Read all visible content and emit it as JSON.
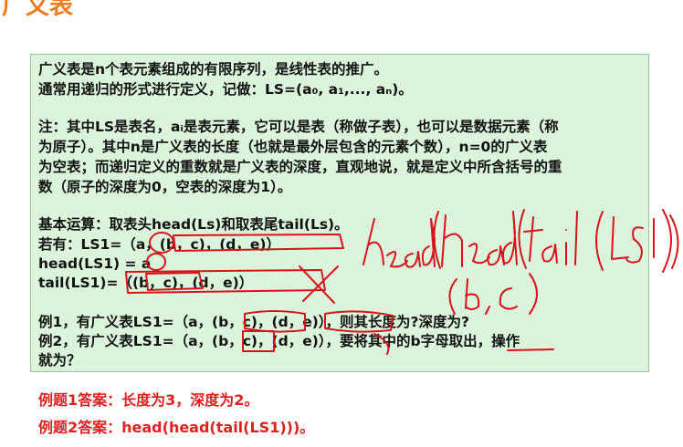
{
  "corner_title": "广义表",
  "box": {
    "lines": [
      "广义表是n个表元素组成的有限序列，是线性表的推广。",
      "通常用递归的形式进行定义，记做：LS=(a₀, a₁,..., aₙ)。",
      "注：其中LS是表名，aᵢ是表元素，它可以是表（称做子表），也可以是数据元素（称",
      "为原子）。其中n是广义表的长度（也就是最外层包含的元素个数），n=0的广义表",
      "为空表；而递归定义的重数就是广义表的深度，直观地说，就是定义中所含括号的重",
      "数（原子的深度为0，空表的深度为1）。",
      "基本运算：取表头head(Ls)和取表尾tail(Ls)。",
      "若有：LS1=（a，(b，c)，(d，e)）",
      "head(LS1) = a",
      "tail(LS1)=（(b，c)，(d，e)）",
      "例1，有广义表LS1=（a，(b，c)，(d，e)），则其长度为?深度为?",
      "例2，有广义表LS1=（a，(b，c)，(d，e)），要将其中的b字母取出，操作",
      "就为？"
    ]
  },
  "answers": [
    "例题1答案：长度为3，深度为2。",
    "例题2答案：head(head(tail(LS1)))。"
  ],
  "handwriting": {
    "expression": "head(head(tail(LS1))",
    "result": "(b,c)"
  }
}
